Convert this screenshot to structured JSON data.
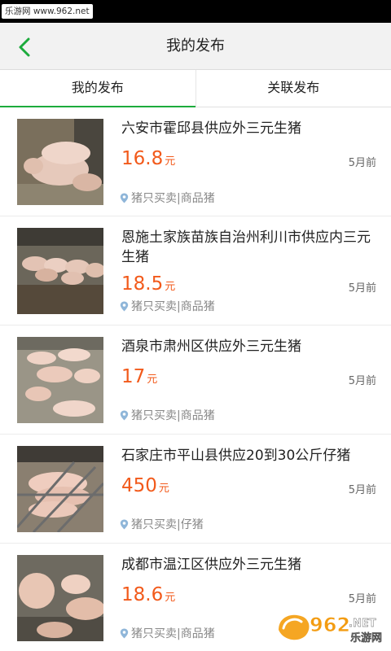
{
  "status_bar": {
    "watermark": "乐游网 www.962.net"
  },
  "header": {
    "title": "我的发布"
  },
  "tabs": [
    {
      "label": "我的发布",
      "active": true
    },
    {
      "label": "关联发布",
      "active": false
    }
  ],
  "accent_color": "#1cab3c",
  "price_color": "#f25a1b",
  "items": [
    {
      "title": "六安市霍邱县供应外三元生猪",
      "price": "16.8",
      "unit": "元",
      "time": "5月前",
      "meta": "猪只买卖|商品猪"
    },
    {
      "title": "恩施土家族苗族自治州利川市供应内三元生猪",
      "price": "18.5",
      "unit": "元",
      "time": "5月前",
      "meta": "猪只买卖|商品猪"
    },
    {
      "title": "酒泉市肃州区供应外三元生猪",
      "price": "17",
      "unit": "元",
      "time": "5月前",
      "meta": "猪只买卖|商品猪"
    },
    {
      "title": "石家庄市平山县供应20到30公斤仔猪",
      "price": "450",
      "unit": "元",
      "time": "5月前",
      "meta": "猪只买卖|仔猪"
    },
    {
      "title": "成都市温江区供应外三元生猪",
      "price": "18.6",
      "unit": "元",
      "time": "5月前",
      "meta": "猪只买卖|商品猪"
    }
  ],
  "watermark_logo": {
    "number": "962",
    "suffix": ".NET",
    "text": "乐游网"
  }
}
